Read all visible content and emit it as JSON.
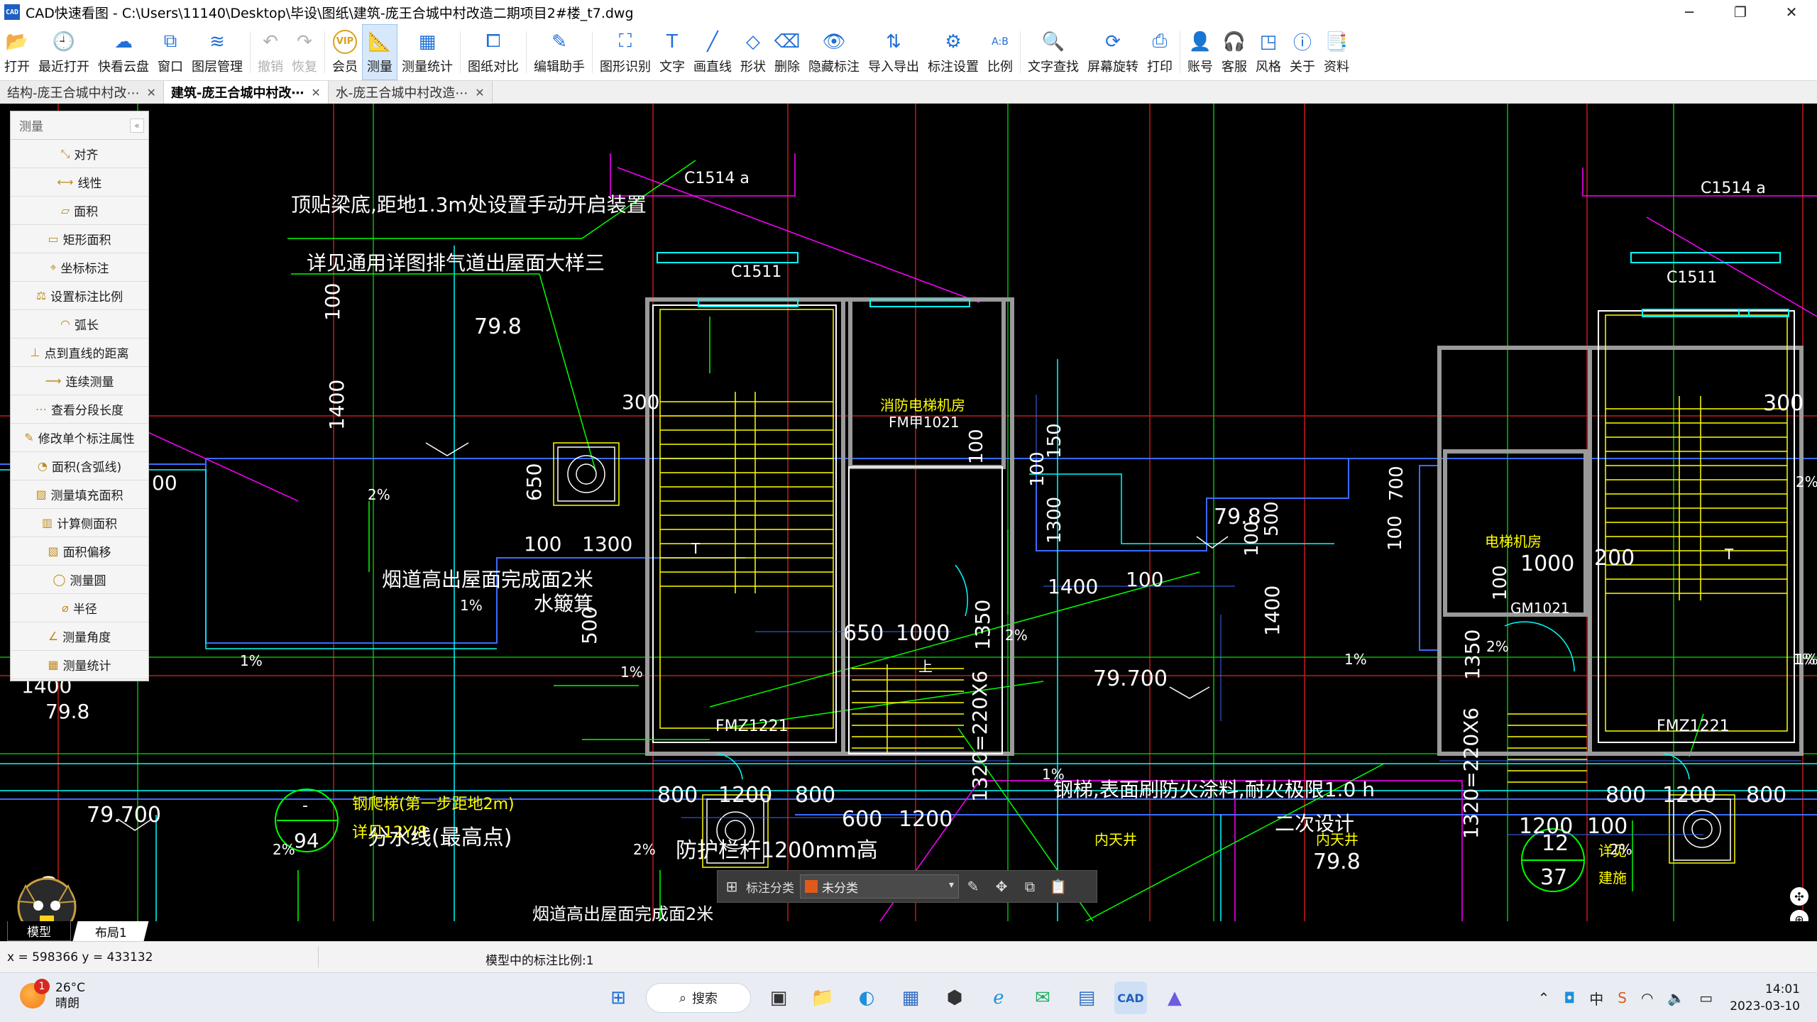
{
  "window": {
    "title": "CAD快速看图 - C:\\Users\\11140\\Desktop\\毕设\\图纸\\建筑-庞王合城中村改造二期项目2#楼_t7.dwg",
    "app_icon_text": "CAD"
  },
  "ribbon": [
    {
      "label": "打开",
      "icon": "folder-icon",
      "glyph": "📂"
    },
    {
      "label": "最近打开",
      "icon": "clock-icon",
      "glyph": "🕘"
    },
    {
      "label": "快看云盘",
      "icon": "cloud-icon",
      "glyph": "☁"
    },
    {
      "label": "窗口",
      "icon": "window-icon",
      "glyph": "⧉"
    },
    {
      "label": "图层管理",
      "icon": "layers-icon",
      "glyph": "≋"
    },
    {
      "label": "撤销",
      "icon": "undo-icon",
      "glyph": "↶",
      "disabled": true
    },
    {
      "label": "恢复",
      "icon": "redo-icon",
      "glyph": "↷",
      "disabled": true
    },
    {
      "label": "会员",
      "icon": "vip-icon",
      "glyph": "VIP"
    },
    {
      "label": "测量",
      "icon": "measure-icon",
      "glyph": "📐",
      "active": true
    },
    {
      "label": "测量统计",
      "icon": "measure-stats-icon",
      "glyph": "▦"
    },
    {
      "label": "图纸对比",
      "icon": "compare-icon",
      "glyph": "⧠"
    },
    {
      "label": "编辑助手",
      "icon": "edit-assistant-icon",
      "glyph": "✎"
    },
    {
      "label": "图形识别",
      "icon": "shape-recognize-icon",
      "glyph": "⛶"
    },
    {
      "label": "文字",
      "icon": "text-icon",
      "glyph": "T"
    },
    {
      "label": "画直线",
      "icon": "line-icon",
      "glyph": "╱"
    },
    {
      "label": "形状",
      "icon": "shape-icon",
      "glyph": "◇"
    },
    {
      "label": "删除",
      "icon": "eraser-icon",
      "glyph": "⌫"
    },
    {
      "label": "隐藏标注",
      "icon": "hide-annotation-icon",
      "glyph": "👁"
    },
    {
      "label": "导入导出",
      "icon": "import-export-icon",
      "glyph": "⇅"
    },
    {
      "label": "标注设置",
      "icon": "annotation-settings-icon",
      "glyph": "⚙"
    },
    {
      "label": "比例",
      "icon": "scale-icon",
      "glyph": "A:B"
    },
    {
      "label": "文字查找",
      "icon": "text-search-icon",
      "glyph": "🔍"
    },
    {
      "label": "屏幕旋转",
      "icon": "rotate-icon",
      "glyph": "⟳"
    },
    {
      "label": "打印",
      "icon": "print-icon",
      "glyph": "⎙"
    },
    {
      "label": "账号",
      "icon": "account-icon",
      "glyph": "👤"
    },
    {
      "label": "客服",
      "icon": "headset-icon",
      "glyph": "🎧"
    },
    {
      "label": "风格",
      "icon": "style-icon",
      "glyph": "◳"
    },
    {
      "label": "关于",
      "icon": "info-icon",
      "glyph": "ⓘ"
    },
    {
      "label": "资料",
      "icon": "docs-icon",
      "glyph": "📑"
    }
  ],
  "tabs": [
    {
      "label": "结构-庞王合城中村改⋯",
      "active": false
    },
    {
      "label": "建筑-庞王合城中村改⋯",
      "active": true
    },
    {
      "label": "水-庞王合城中村改造⋯",
      "active": false
    }
  ],
  "measure_panel": {
    "title": "测量",
    "items": [
      {
        "label": "对齐",
        "icon": "align-measure-icon"
      },
      {
        "label": "线性",
        "icon": "linear-measure-icon"
      },
      {
        "label": "面积",
        "icon": "area-icon"
      },
      {
        "label": "矩形面积",
        "icon": "rect-area-icon"
      },
      {
        "label": "坐标标注",
        "icon": "coordinate-icon"
      },
      {
        "label": "设置标注比例",
        "icon": "set-scale-icon"
      },
      {
        "label": "弧长",
        "icon": "arc-length-icon"
      },
      {
        "label": "点到直线的距离",
        "icon": "point-line-distance-icon"
      },
      {
        "label": "连续测量",
        "icon": "continuous-measure-icon"
      },
      {
        "label": "查看分段长度",
        "icon": "segment-length-icon"
      },
      {
        "label": "修改单个标注属性",
        "icon": "edit-annotation-icon"
      },
      {
        "label": "面积(含弧线)",
        "icon": "arc-area-icon"
      },
      {
        "label": "测量填充面积",
        "icon": "fill-area-icon"
      },
      {
        "label": "计算侧面积",
        "icon": "side-area-icon"
      },
      {
        "label": "面积偏移",
        "icon": "area-offset-icon"
      },
      {
        "label": "测量圆",
        "icon": "circle-measure-icon"
      },
      {
        "label": "半径",
        "icon": "radius-icon"
      },
      {
        "label": "测量角度",
        "icon": "angle-icon"
      },
      {
        "label": "测量统计",
        "icon": "measure-stats-icon"
      }
    ]
  },
  "drawing_text": {
    "c1514a_left": "C1514 a",
    "c1514a_right": "C1514 a",
    "c1511_left": "C1511",
    "c1511_right": "C1511",
    "note_beam": "顶贴梁底,距地1.3m处设置手动开启装置",
    "note_exhaust": "详见通用详图排气道出屋面大样三",
    "elev_798_top": "79.8",
    "dim_100_a": "100",
    "dim_1400_a": "1400",
    "dim_300_left": "300",
    "dim_650": "650",
    "dim_100_b": "100",
    "dim_1300_a": "1300",
    "dim_00_edge": "00",
    "slope_2a": "2%",
    "note_chimney": "烟道高出屋面完成面2米",
    "note_water": "水簸箕",
    "slope_1a": "1%",
    "slope_1b": "1%",
    "dim_500_left": "500",
    "slope_1c": "1%",
    "elev_1400_left": "1400",
    "elev_798_left": "79.8",
    "circle_ref_top": "-",
    "circle_ref_94": "94",
    "note_ladder": "钢爬梯(第一步距地2m)",
    "note_ref_12yj8": "详见12YJ8",
    "elev_79700_left": "79.700",
    "note_watershed": "分水线(最高点)",
    "slope_2b": "2%",
    "slope_2c": "2%",
    "dim_600_left": "600",
    "note_bottom_cut": "烟道高出屋面完成面2米",
    "room_fire_elevator": "消防电梯机房",
    "door_fm1021": "FM甲1021",
    "dim_100_mid": "100",
    "dim_150": "150",
    "dim_1300_mid": "1300",
    "dim_100_mid2": "100",
    "dim_1400_mid": "1400",
    "dim_100_mid3": "100",
    "dim_650_mid": "650",
    "dim_1000_mid": "1000",
    "dim_1350_mid": "1350",
    "slope_2d": "2%",
    "door_fmz1221_left": "FMZ1221",
    "stair_dim_left": "1320=220X6",
    "dim_800_a": "800",
    "dim_1200_a": "1200",
    "dim_800_b": "800",
    "dim_600_mid": "600",
    "dim_1200_mid": "1200",
    "note_railing": "防护栏杆1200mm高",
    "elev_798_mid": "79.8",
    "dim_100_mid4": "100",
    "dim_500_mid": "500",
    "elev_79700_mid": "79.700",
    "dim_1400_mid2": "1400",
    "dim_100_mid5": "100",
    "dim_700_mid": "700",
    "slope_1d": "1%",
    "note_steel_stair": "钢梯,表面刷防火涂料,耐火极限1.0 h",
    "note_second_design": "二次设计",
    "room_elevator": "电梯机房",
    "dim_1000_right": "1000",
    "dim_200_right": "200",
    "door_gm1021": "GM1021",
    "dim_100_right": "100",
    "dim_300_right": "300",
    "dim_1350_right": "1350",
    "slope_2e": "2%",
    "door_fmz1221_right": "FMZ1221",
    "stair_dim_right": "1320=220X6",
    "dim_1200_right": "1200",
    "dim_100_right2": "100",
    "dim_800_c": "800",
    "dim_1200_b": "1200",
    "dim_800_d": "800",
    "circle_ref_12": "12",
    "circle_ref_37": "37",
    "note_see": "详见",
    "note_build": "建施",
    "slope_1e": "1%",
    "slope_1f": "1%",
    "slope_2f": "2%",
    "courtyard_a": "内天井",
    "courtyard_b": "内天井",
    "elev_798_bottom": "79.8",
    "stair_up_left": "T",
    "stair_up_mid": "上",
    "stair_up_right": "T",
    "edge_right_1": "1%",
    "edge_right_2": "2%"
  },
  "anno_toolbar": {
    "label": "标注分类",
    "selected": "未分类",
    "swatch_color": "#e05a1a"
  },
  "layout_tabs": {
    "model": "模型",
    "layout1": "布局1"
  },
  "statusbar": {
    "coords": "x = 598366  y = 433132",
    "scale": "模型中的标注比例:1"
  },
  "taskbar": {
    "weather_temp": "26°C",
    "weather_desc": "晴朗",
    "notification_count": "1",
    "search_label": "搜索",
    "time": "14:01",
    "date": "2023-03-10"
  },
  "colors": {
    "wall_white": "#ffffff",
    "cyan": "#00ffff",
    "blue": "#3a6cff",
    "green": "#00ff00",
    "yellow": "#ffff00",
    "magenta": "#ff00ff",
    "red": "#ff2020",
    "grey": "#9a9a9a"
  }
}
